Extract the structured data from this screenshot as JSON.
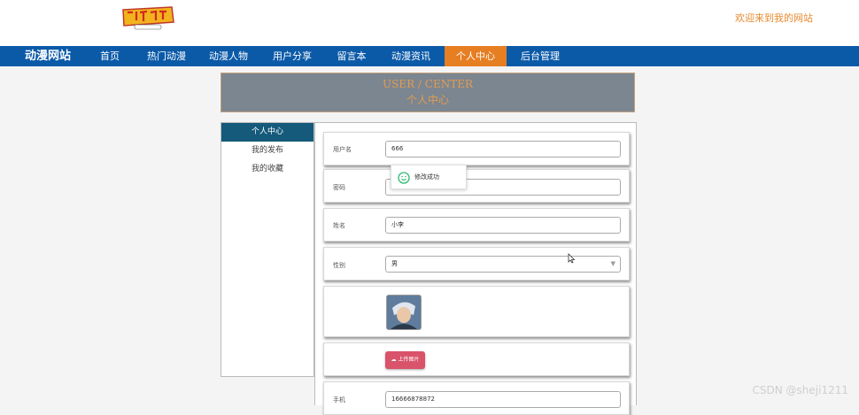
{
  "header": {
    "welcome": "欢迎来到我的网站",
    "logo_icon": "digimon-logo-icon"
  },
  "nav": {
    "brand": "动漫网站",
    "items": [
      {
        "label": "首页"
      },
      {
        "label": "热门动漫"
      },
      {
        "label": "动漫人物"
      },
      {
        "label": "用户分享"
      },
      {
        "label": "留言本"
      },
      {
        "label": "动漫资讯"
      },
      {
        "label": "个人中心",
        "active": true
      },
      {
        "label": "后台管理"
      }
    ],
    "bar_color": "#0b5aa8",
    "active_color": "#e67e22"
  },
  "page_title": {
    "en": "USER / CENTER",
    "zh": "个人中心"
  },
  "sidebar": {
    "items": [
      {
        "label": "个人中心",
        "active": true
      },
      {
        "label": "我的发布"
      },
      {
        "label": "我的收藏"
      }
    ]
  },
  "form": {
    "username": {
      "label": "用户名",
      "value": "666"
    },
    "password": {
      "label": "密码",
      "value": ""
    },
    "name": {
      "label": "姓名",
      "value": "小李"
    },
    "gender": {
      "label": "性别",
      "value": "男"
    },
    "avatar_icon": "avatar-image",
    "upload_label": "上传图片",
    "phone": {
      "label": "手机",
      "value": "16666878872"
    }
  },
  "toast": {
    "message": "修改成功",
    "icon": "smile-icon"
  },
  "watermark": "CSDN @sheji1211"
}
